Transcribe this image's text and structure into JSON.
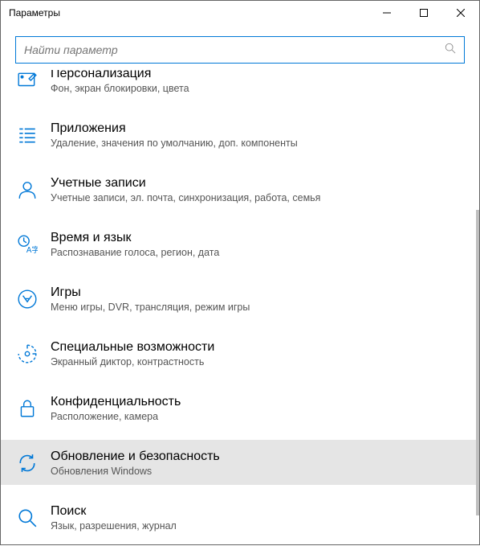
{
  "window": {
    "title": "Параметры"
  },
  "search": {
    "placeholder": "Найти параметр"
  },
  "items": [
    {
      "title": "Персонализация",
      "desc": "Фон, экран блокировки, цвета"
    },
    {
      "title": "Приложения",
      "desc": "Удаление, значения по умолчанию, доп. компоненты"
    },
    {
      "title": "Учетные записи",
      "desc": "Учетные записи, эл. почта, синхронизация, работа, семья"
    },
    {
      "title": "Время и язык",
      "desc": "Распознавание голоса, регион, дата"
    },
    {
      "title": "Игры",
      "desc": "Меню игры, DVR, трансляция, режим игры"
    },
    {
      "title": "Специальные возможности",
      "desc": "Экранный диктор, контрастность"
    },
    {
      "title": "Конфиденциальность",
      "desc": "Расположение, камера"
    },
    {
      "title": "Обновление и безопасность",
      "desc": "Обновления Windows"
    },
    {
      "title": "Поиск",
      "desc": "Язык, разрешения, журнал"
    }
  ]
}
